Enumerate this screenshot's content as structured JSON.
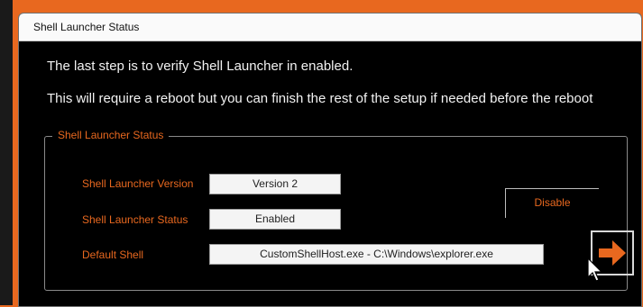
{
  "window": {
    "title": "Shell Launcher Status"
  },
  "intro": {
    "line1": "The last step is to verify Shell Launcher in enabled.",
    "line2": "This will require a reboot but you can finish the rest of the setup if needed before the reboot"
  },
  "group": {
    "legend": "Shell Launcher Status",
    "fields": [
      {
        "label": "Shell Launcher Version",
        "value": "Version 2"
      },
      {
        "label": "Shell Launcher Status",
        "value": "Enabled"
      },
      {
        "label": "Default Shell",
        "value": "CustomShellHost.exe - C:\\Windows\\explorer.exe"
      }
    ],
    "disable_label": "Disable"
  },
  "colors": {
    "accent": "#e8681f",
    "background": "#000000"
  },
  "icons": {
    "go": "arrow-right-icon",
    "cursor": "mouse-cursor-icon"
  }
}
